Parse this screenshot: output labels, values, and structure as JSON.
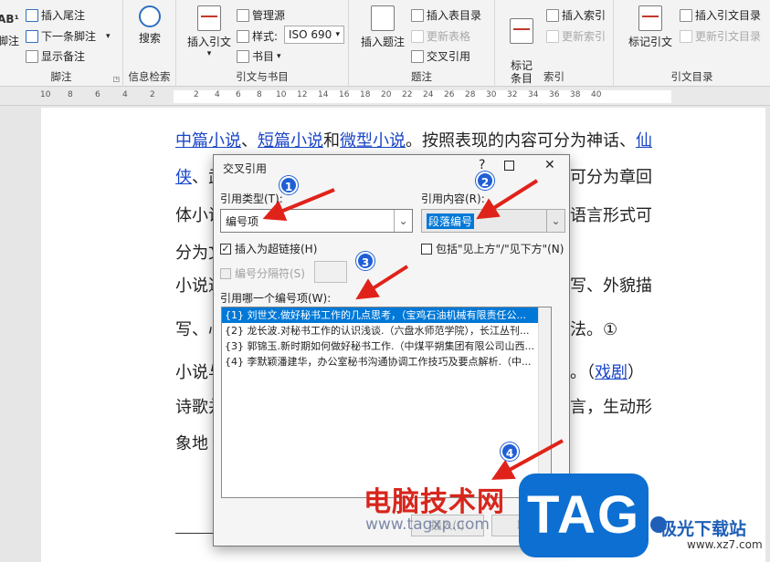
{
  "ribbon": {
    "footnotes": {
      "insert_endnote": "插入尾注",
      "next_footnote": "下一条脚注",
      "show_notes": "显示备注",
      "footnote_btn": "脚注",
      "label": "脚注",
      "ab_glyph": "AB¹"
    },
    "research": {
      "search": "搜索",
      "label": "信息检索"
    },
    "citations": {
      "insert_citation": "插入引文",
      "manage_sources": "管理源",
      "style_label": "样式:",
      "style_value": "ISO 690",
      "bibliography": "书目",
      "label": "引文与书目"
    },
    "captions": {
      "insert_caption": "插入题注",
      "insert_table_of_figures": "插入表目录",
      "update_table": "更新表格",
      "cross_reference": "交叉引用",
      "label": "题注"
    },
    "index": {
      "mark_entry": "标记\n条目",
      "insert_index": "插入索引",
      "update_index": "更新索引",
      "label": "索引"
    },
    "toa": {
      "mark_citation": "标记引文",
      "insert_toa": "插入引文目录",
      "update_toa": "更新引文目录",
      "label": "引文目录"
    }
  },
  "ruler": {
    "ticks": [
      "10",
      "8",
      "6",
      "4",
      "2",
      "2",
      "4",
      "6",
      "8",
      "10",
      "12",
      "14",
      "16",
      "18",
      "20",
      "22",
      "24",
      "26",
      "28",
      "30",
      "32",
      "34",
      "36",
      "38",
      "40"
    ]
  },
  "document": {
    "l1": {
      "a": "中篇小说",
      "s1": "、",
      "b": "短篇小说",
      "s2": "和",
      "c": "微型小说",
      "s3": "。按照表现的内容可分为神话、",
      "d": "仙"
    },
    "l2": {
      "a": "侠",
      "s1": "、武",
      "r": "可分为章回"
    },
    "l3": {
      "a": "体小说",
      "r": "语言形式可"
    },
    "l4": {
      "a": "分为文"
    },
    "l5": {
      "a": "小说通",
      "r": "写、外貌描"
    },
    "l6": {
      "a": "写、心",
      "r": "法。①"
    },
    "l7": {
      "a": "小说与",
      "r": "。（",
      "link": "戏剧",
      "r2": "）"
    },
    "l8": {
      "a": "诗歌并",
      "r": "言，生动形"
    },
    "l9": {
      "a": "象地"
    }
  },
  "dialog": {
    "title": "交叉引用",
    "help": "?",
    "close": "✕",
    "ref_type_label": "引用类型(T):",
    "ref_type_value": "编号项",
    "ref_content_label": "引用内容(R):",
    "ref_content_value": "段落编号",
    "insert_hyperlink": "插入为超链接(H)",
    "include_above_below": "包括\"见上方\"/\"见下方\"(N)",
    "separate_numbers": "编号分隔符(S)",
    "which_item_label": "引用哪一个编号项(W):",
    "items": [
      "{1} 刘世文.做好秘书工作的几点思考，（宝鸡石油机械有限责任公...",
      "{2} 龙长波.对秘书工作的认识浅谈.（六盘水师范学院），长江丛刊...",
      "{3} 郭锦玉.新时期如何做好秘书工作.（中煤平朔集团有限公司山西...",
      "{4} 李默颖潘建华，办公室秘书沟通协调工作技巧及要点解析.（中..."
    ],
    "insert_btn": "插入(I)",
    "cancel_btn": "取消"
  },
  "annotations": {
    "n1": "1",
    "n2": "2",
    "n3": "3",
    "n4": "4",
    "arrow_color": "#e0231a",
    "badge_color": "#1f5fd6"
  },
  "watermarks": {
    "w1": "电脑技术网",
    "w2": "www.tagxp.com",
    "tag": "TAG",
    "w3": "极光下载站",
    "w4": "www.xz7.com"
  }
}
